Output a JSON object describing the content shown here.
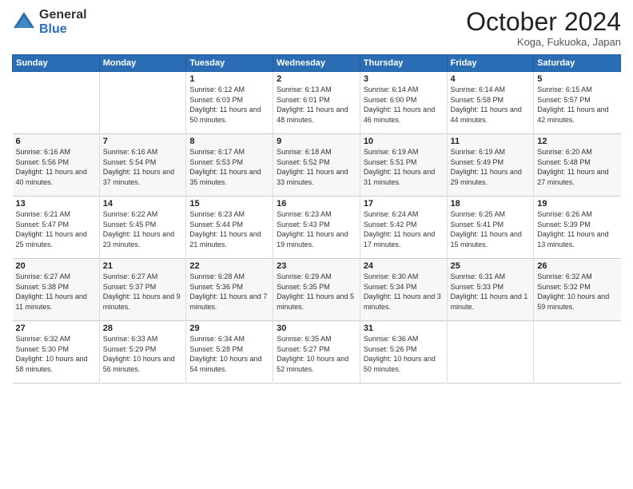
{
  "logo": {
    "general": "General",
    "blue": "Blue"
  },
  "header": {
    "month": "October 2024",
    "location": "Koga, Fukuoka, Japan"
  },
  "days_of_week": [
    "Sunday",
    "Monday",
    "Tuesday",
    "Wednesday",
    "Thursday",
    "Friday",
    "Saturday"
  ],
  "weeks": [
    [
      {
        "day": "",
        "info": ""
      },
      {
        "day": "",
        "info": ""
      },
      {
        "day": "1",
        "info": "Sunrise: 6:12 AM\nSunset: 6:03 PM\nDaylight: 11 hours and 50 minutes."
      },
      {
        "day": "2",
        "info": "Sunrise: 6:13 AM\nSunset: 6:01 PM\nDaylight: 11 hours and 48 minutes."
      },
      {
        "day": "3",
        "info": "Sunrise: 6:14 AM\nSunset: 6:00 PM\nDaylight: 11 hours and 46 minutes."
      },
      {
        "day": "4",
        "info": "Sunrise: 6:14 AM\nSunset: 5:58 PM\nDaylight: 11 hours and 44 minutes."
      },
      {
        "day": "5",
        "info": "Sunrise: 6:15 AM\nSunset: 5:57 PM\nDaylight: 11 hours and 42 minutes."
      }
    ],
    [
      {
        "day": "6",
        "info": "Sunrise: 6:16 AM\nSunset: 5:56 PM\nDaylight: 11 hours and 40 minutes."
      },
      {
        "day": "7",
        "info": "Sunrise: 6:16 AM\nSunset: 5:54 PM\nDaylight: 11 hours and 37 minutes."
      },
      {
        "day": "8",
        "info": "Sunrise: 6:17 AM\nSunset: 5:53 PM\nDaylight: 11 hours and 35 minutes."
      },
      {
        "day": "9",
        "info": "Sunrise: 6:18 AM\nSunset: 5:52 PM\nDaylight: 11 hours and 33 minutes."
      },
      {
        "day": "10",
        "info": "Sunrise: 6:19 AM\nSunset: 5:51 PM\nDaylight: 11 hours and 31 minutes."
      },
      {
        "day": "11",
        "info": "Sunrise: 6:19 AM\nSunset: 5:49 PM\nDaylight: 11 hours and 29 minutes."
      },
      {
        "day": "12",
        "info": "Sunrise: 6:20 AM\nSunset: 5:48 PM\nDaylight: 11 hours and 27 minutes."
      }
    ],
    [
      {
        "day": "13",
        "info": "Sunrise: 6:21 AM\nSunset: 5:47 PM\nDaylight: 11 hours and 25 minutes."
      },
      {
        "day": "14",
        "info": "Sunrise: 6:22 AM\nSunset: 5:45 PM\nDaylight: 11 hours and 23 minutes."
      },
      {
        "day": "15",
        "info": "Sunrise: 6:23 AM\nSunset: 5:44 PM\nDaylight: 11 hours and 21 minutes."
      },
      {
        "day": "16",
        "info": "Sunrise: 6:23 AM\nSunset: 5:43 PM\nDaylight: 11 hours and 19 minutes."
      },
      {
        "day": "17",
        "info": "Sunrise: 6:24 AM\nSunset: 5:42 PM\nDaylight: 11 hours and 17 minutes."
      },
      {
        "day": "18",
        "info": "Sunrise: 6:25 AM\nSunset: 5:41 PM\nDaylight: 11 hours and 15 minutes."
      },
      {
        "day": "19",
        "info": "Sunrise: 6:26 AM\nSunset: 5:39 PM\nDaylight: 11 hours and 13 minutes."
      }
    ],
    [
      {
        "day": "20",
        "info": "Sunrise: 6:27 AM\nSunset: 5:38 PM\nDaylight: 11 hours and 11 minutes."
      },
      {
        "day": "21",
        "info": "Sunrise: 6:27 AM\nSunset: 5:37 PM\nDaylight: 11 hours and 9 minutes."
      },
      {
        "day": "22",
        "info": "Sunrise: 6:28 AM\nSunset: 5:36 PM\nDaylight: 11 hours and 7 minutes."
      },
      {
        "day": "23",
        "info": "Sunrise: 6:29 AM\nSunset: 5:35 PM\nDaylight: 11 hours and 5 minutes."
      },
      {
        "day": "24",
        "info": "Sunrise: 6:30 AM\nSunset: 5:34 PM\nDaylight: 11 hours and 3 minutes."
      },
      {
        "day": "25",
        "info": "Sunrise: 6:31 AM\nSunset: 5:33 PM\nDaylight: 11 hours and 1 minute."
      },
      {
        "day": "26",
        "info": "Sunrise: 6:32 AM\nSunset: 5:32 PM\nDaylight: 10 hours and 59 minutes."
      }
    ],
    [
      {
        "day": "27",
        "info": "Sunrise: 6:32 AM\nSunset: 5:30 PM\nDaylight: 10 hours and 58 minutes."
      },
      {
        "day": "28",
        "info": "Sunrise: 6:33 AM\nSunset: 5:29 PM\nDaylight: 10 hours and 56 minutes."
      },
      {
        "day": "29",
        "info": "Sunrise: 6:34 AM\nSunset: 5:28 PM\nDaylight: 10 hours and 54 minutes."
      },
      {
        "day": "30",
        "info": "Sunrise: 6:35 AM\nSunset: 5:27 PM\nDaylight: 10 hours and 52 minutes."
      },
      {
        "day": "31",
        "info": "Sunrise: 6:36 AM\nSunset: 5:26 PM\nDaylight: 10 hours and 50 minutes."
      },
      {
        "day": "",
        "info": ""
      },
      {
        "day": "",
        "info": ""
      }
    ]
  ]
}
